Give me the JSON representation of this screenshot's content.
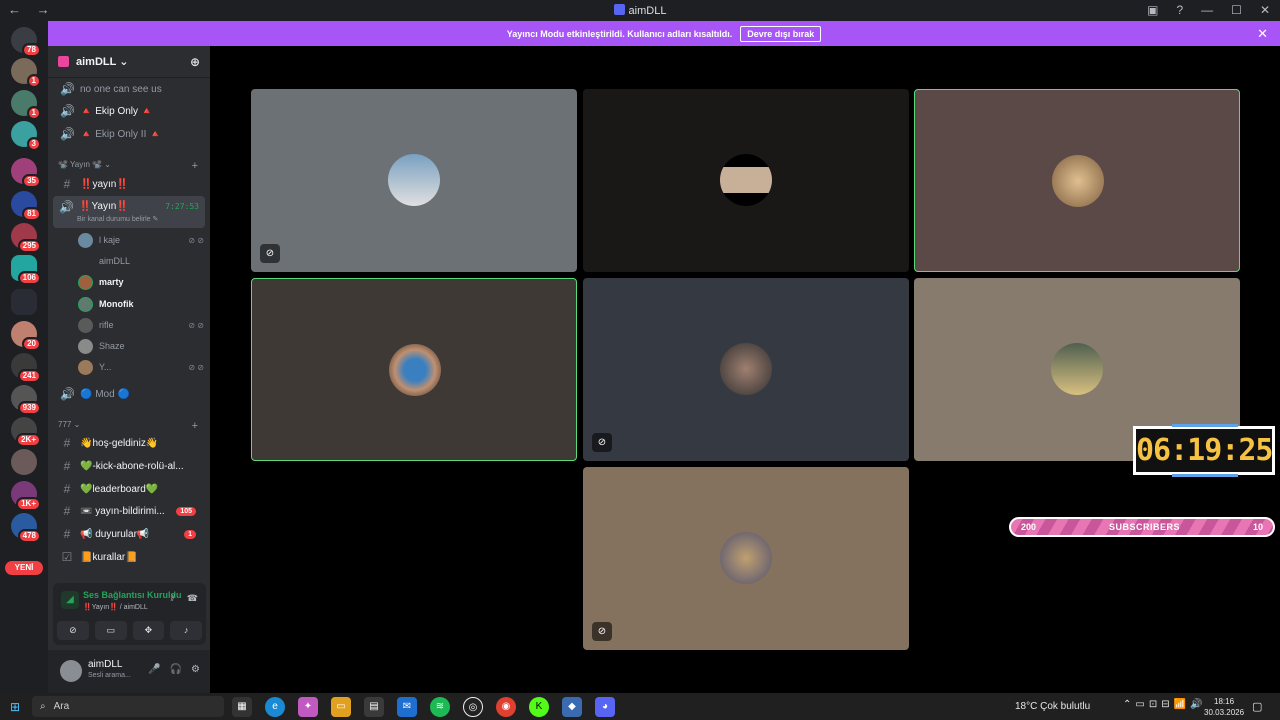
{
  "window": {
    "title": "aimDLL"
  },
  "banner": {
    "message": "Yayıncı Modu etkinleştirildi. Kullanıcı adları kısaltıldı.",
    "button": "Devre dışı bırak"
  },
  "servers": {
    "badges": [
      "78",
      "1",
      "1",
      "3",
      "35",
      "81",
      "295",
      "106",
      "20",
      "241",
      "939",
      "2K+",
      "1K+",
      "478"
    ],
    "new_label": "YENİ"
  },
  "guild": {
    "name": "aimDLL ⌄"
  },
  "channels": {
    "top": [
      "no one can see us",
      "🔺 Ekip Only 🔺",
      "🔺 Ekip Only II 🔺"
    ],
    "category1": "📽️ Yayın 📽️ ⌄",
    "text1": "‼️yayın‼️",
    "active_voice": {
      "name": "‼️Yayın‼️",
      "timer": "7:27:53",
      "status": "Bir kanal durumu belirle ✎"
    },
    "voice_users": [
      "l kaje",
      "aimDLL",
      "marty",
      "Monofik",
      "rifle",
      "Shaze",
      "Y..."
    ],
    "mod": "🔵 Mod 🔵",
    "category2": "777 ⌄",
    "text_channels": [
      "👋hoş-geldiniz👋",
      "💚-kick-abone-rolü-al...",
      "💚leaderboard💚",
      "📼 yayın-bildirimi...",
      "📢 duyurular📢",
      "📙kurallar📙"
    ],
    "unread": [
      "105",
      "1"
    ]
  },
  "voice_panel": {
    "connected": "Ses Bağlantısı Kuruldu",
    "location": "‼️Yayın‼️ / aimDLL"
  },
  "user_panel": {
    "name": "aimDLL",
    "status": "Sesli arama..."
  },
  "overlay": {
    "clock": "06:19:25",
    "subs_left": "200",
    "subs_label": "SUBSCRIBERS",
    "subs_right": "10"
  },
  "taskbar": {
    "search_placeholder": "Ara",
    "weather": "18°C  Çok bulutlu",
    "time": "18:16",
    "date": "30.03.2026"
  },
  "colors": {
    "accent": "#5865f2",
    "banner": "#a855f7",
    "speaking": "#5bd97a",
    "unread": "#f23f43",
    "clock": "#f6c244"
  }
}
